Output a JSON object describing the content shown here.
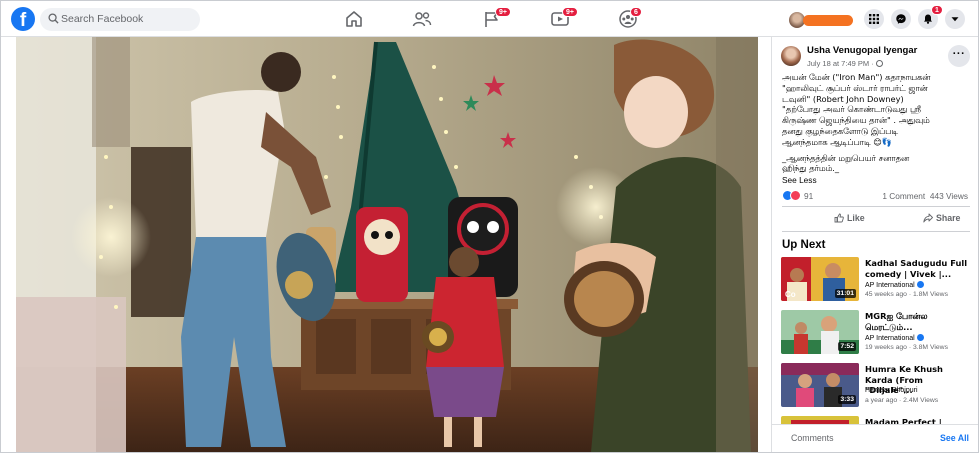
{
  "nav": {
    "search_placeholder": "Search Facebook",
    "friends_badge": "",
    "pages_badge": "9+",
    "watch_badge": "9+",
    "groups_badge": "6",
    "notifications_badge": "1"
  },
  "post": {
    "author": "Usha Venugopal Iyengar",
    "date": "July 18 at 7:49 PM · ",
    "text_lines": [
      "அயன் மேன் (\"Iron Man\") கதாநாயகன்",
      "\"ஹாலிவுட் சூப்பர் ஸ்டார் ராபர்ட் ஜான்",
      "டவுனி\" (Robert John Downey)",
      "\"தற்போது அவர் கொண்டாடுவது ஸ்ரீ",
      "கிருஷ்ண ஜெயந்தியை தான்\" . அதுவும்",
      "தனது குழந்தைகளோடு இப்படி",
      "ஆனந்தமாக ஆடிப்பாடி 😊👣"
    ],
    "second_para": "_ஆனந்தத்தின் மறுபெயர் சனாதன தர்மம்._",
    "second_para_lines": [
      "_ஆனந்தத்தின் மறுபெயர் சனாதன",
      "ஹிந்து தர்மம்._"
    ],
    "see_less": "See Less",
    "reaction_count": "91",
    "comments": "1 Comment",
    "views": "443 Views",
    "like_label": "Like",
    "share_label": "Share"
  },
  "up_next": {
    "heading": "Up Next",
    "items": [
      {
        "title_line1": "Kadhal Sadugudu Full",
        "title_line2": "comedy | Vivek |...",
        "channel": "AP International",
        "meta": "45 weeks ago · 1.8M Views",
        "duration": "31:01"
      },
      {
        "title_line1": "MGRஐ போன்ல",
        "title_line2": "மெரட்டும்...",
        "channel": "AP International",
        "meta": "19 weeks ago · 3.8M Views",
        "duration": "7:52"
      },
      {
        "title_line1": "Humra Ke Khush",
        "title_line2": "Karda (From \"Diljale\"...",
        "channel": "Hamaar Bhojpuri",
        "meta": "a year ago · 2.4M Views",
        "duration": "3:33"
      },
      {
        "title_line1": "Madam Perfect |",
        "title_line2": "",
        "channel": "",
        "meta": "",
        "duration": ""
      }
    ]
  },
  "footer": {
    "comments_label": "Comments",
    "see_all": "See All"
  },
  "colors": {
    "brand": "#1877f2",
    "badge": "#e41e3f",
    "account_name_highlight": "#f47221"
  }
}
